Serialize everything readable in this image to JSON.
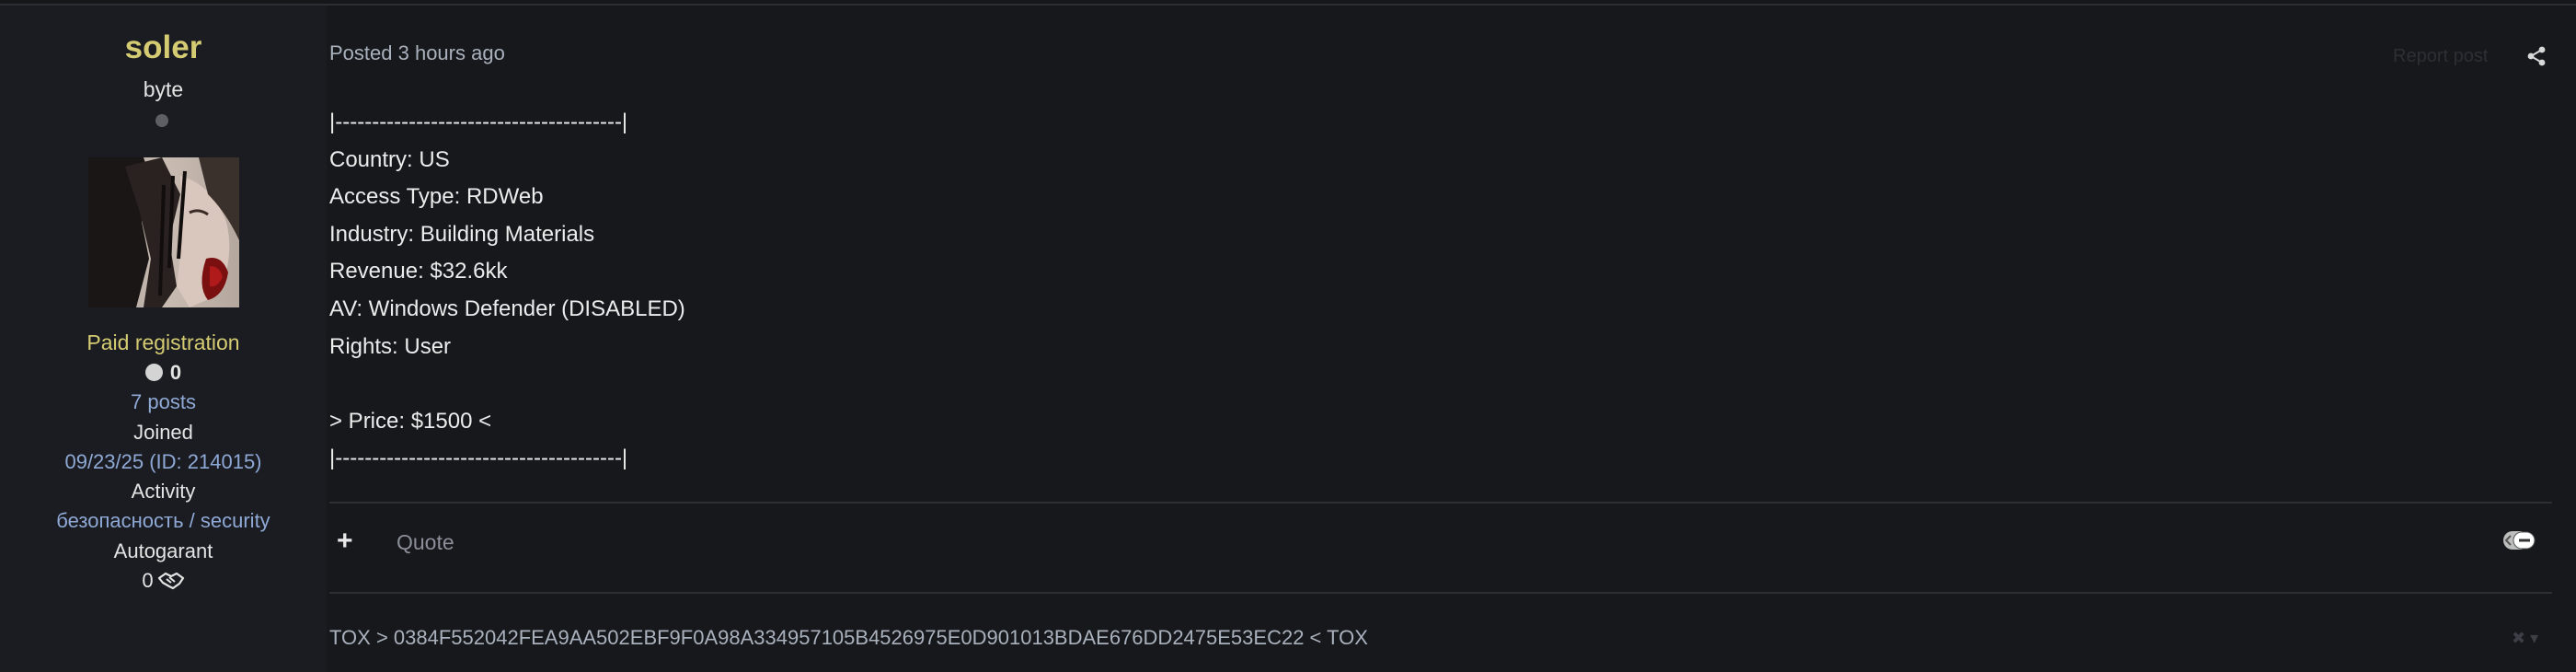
{
  "author": {
    "username": "soler",
    "rank": "byte",
    "group": "Paid registration",
    "reputation": "0",
    "posts": "7 posts",
    "joined_label": "Joined",
    "joined_value": "09/23/25 (ID: 214015)",
    "activity_label": "Activity",
    "activity_value": "безопасность / security",
    "autogarant_label": "Autogarant",
    "autogarant_value": "0",
    "icons": {
      "status": "offline-dot-icon",
      "reputation": "reputation-circle-icon",
      "autogarant": "handshake-icon"
    }
  },
  "post": {
    "meta": "Posted 3 hours ago",
    "report_label": "Report post",
    "body_lines": [
      "|---------------------------------------|",
      "Country: US",
      "Access Type: RDWeb",
      "Industry: Building Materials",
      "Revenue: $32.6kk",
      "AV: Windows Defender (DISABLED)",
      "Rights: User",
      "",
      "> Price: $1500 <",
      "|---------------------------------------|"
    ],
    "actions": {
      "plus_label": "+",
      "quote_label": "Quote"
    },
    "signature": "TOX > 0384F552042FEA9AA502EBF9F0A98A334957105B4526975E0D901013BDAE676DD2475E53EC22 < TOX",
    "signature_controls": "✖ ▾"
  },
  "colors": {
    "username": "#d4cb72",
    "group": "#d4cb72",
    "link": "#8fa9d6",
    "background": "#16171b",
    "sidebar": "#1b1c21"
  }
}
